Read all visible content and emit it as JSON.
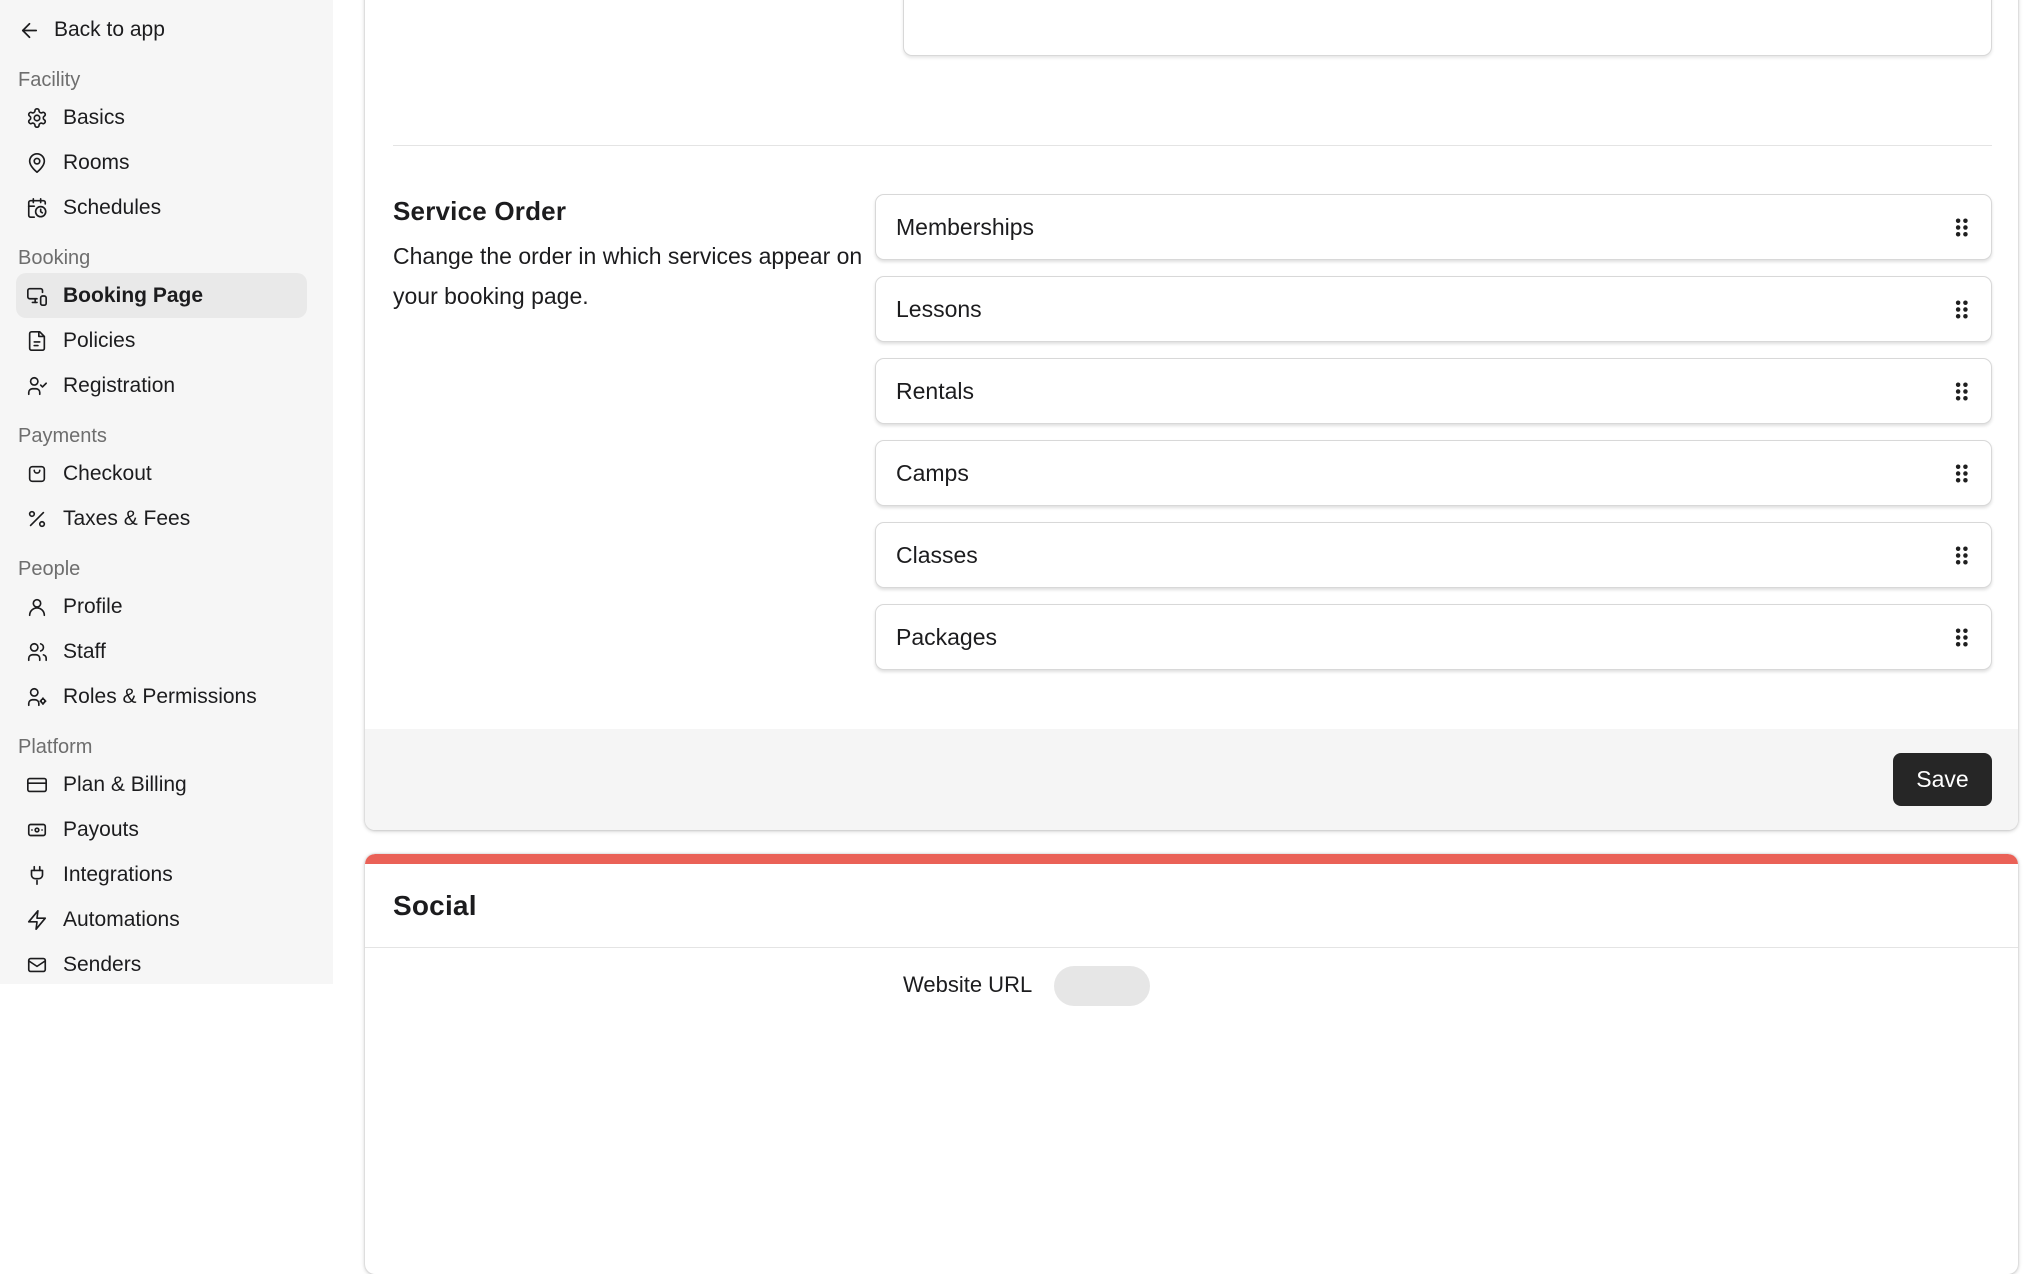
{
  "sidebar": {
    "back": {
      "label": "Back to app",
      "icon": "arrow-left-icon"
    },
    "sections": [
      {
        "heading": "Facility",
        "items": [
          {
            "label": "Basics",
            "icon": "gear-icon",
            "active": false
          },
          {
            "label": "Rooms",
            "icon": "map-pin-icon",
            "active": false
          },
          {
            "label": "Schedules",
            "icon": "calendar-clock-icon",
            "active": false
          }
        ]
      },
      {
        "heading": "Booking",
        "items": [
          {
            "label": "Booking Page",
            "icon": "monitor-smartphone-icon",
            "active": true
          },
          {
            "label": "Policies",
            "icon": "file-text-icon",
            "active": false
          },
          {
            "label": "Registration",
            "icon": "user-check-icon",
            "active": false
          }
        ]
      },
      {
        "heading": "Payments",
        "items": [
          {
            "label": "Checkout",
            "icon": "shopping-bag-icon",
            "active": false
          },
          {
            "label": "Taxes & Fees",
            "icon": "percent-icon",
            "active": false
          }
        ]
      },
      {
        "heading": "People",
        "items": [
          {
            "label": "Profile",
            "icon": "user-icon",
            "active": false
          },
          {
            "label": "Staff",
            "icon": "users-icon",
            "active": false
          },
          {
            "label": "Roles & Permissions",
            "icon": "user-gear-icon",
            "active": false
          }
        ]
      },
      {
        "heading": "Platform",
        "items": [
          {
            "label": "Plan & Billing",
            "icon": "credit-card-icon",
            "active": false
          },
          {
            "label": "Payouts",
            "icon": "banknote-icon",
            "active": false
          },
          {
            "label": "Integrations",
            "icon": "plug-icon",
            "active": false
          },
          {
            "label": "Automations",
            "icon": "zap-icon",
            "active": false
          },
          {
            "label": "Senders",
            "icon": "mail-icon",
            "active": false
          }
        ]
      }
    ]
  },
  "main": {
    "top_field": {
      "value": ""
    },
    "service_order": {
      "title": "Service Order",
      "description": "Change the order in which services appear on your booking page.",
      "drag_icon": "grip-vertical-icon",
      "services": [
        {
          "label": "Memberships"
        },
        {
          "label": "Lessons"
        },
        {
          "label": "Rentals"
        },
        {
          "label": "Camps"
        },
        {
          "label": "Classes"
        },
        {
          "label": "Packages"
        }
      ]
    },
    "footer": {
      "save_label": "Save"
    },
    "social": {
      "title": "Social",
      "website_url_label": "Website URL",
      "badge_label": ""
    }
  },
  "colors": {
    "sidebar_bg": "#f6f6f6",
    "active_item_bg": "#e9e9e9",
    "text": "#1c1c1e",
    "muted_heading": "#6e6e6e",
    "divider": "#e4e4e4",
    "item_border": "#d8d8d8",
    "footer_bg": "#f5f5f5",
    "save_button_bg": "#262626",
    "save_button_text": "#ffffff",
    "accent_red": "#ea6157",
    "badge_bg": "#e6e6e6"
  }
}
